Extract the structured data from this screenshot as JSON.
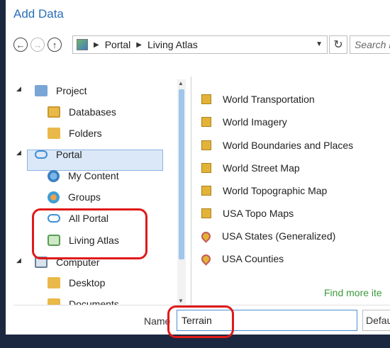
{
  "dialog": {
    "title": "Add Data"
  },
  "nav": {
    "back_icon": "back-arrow-icon",
    "forward_icon": "forward-arrow-icon",
    "up_icon": "up-arrow-icon",
    "breadcrumb": [
      "Portal",
      "Living Atlas"
    ],
    "refresh_icon": "refresh-icon",
    "search_placeholder": "Search L"
  },
  "tree": {
    "items": [
      {
        "label": "Project",
        "icon": "project-icon"
      },
      {
        "label": "Databases",
        "icon": "database-icon"
      },
      {
        "label": "Folders",
        "icon": "folder-icon"
      },
      {
        "label": "Portal",
        "icon": "cloud-icon"
      },
      {
        "label": "My Content",
        "icon": "globe-user-icon"
      },
      {
        "label": "Groups",
        "icon": "groups-icon"
      },
      {
        "label": "All Portal",
        "icon": "cloud-icon"
      },
      {
        "label": "Living Atlas",
        "icon": "living-atlas-icon"
      },
      {
        "label": "Computer",
        "icon": "computer-icon"
      },
      {
        "label": "Desktop",
        "icon": "folder-icon"
      },
      {
        "label": "Documents",
        "icon": "folder-icon"
      }
    ]
  },
  "list": {
    "items": [
      {
        "label": "World Transportation",
        "icon": "map-service-icon"
      },
      {
        "label": "World Imagery",
        "icon": "map-service-icon"
      },
      {
        "label": "World Boundaries and Places",
        "icon": "map-service-icon"
      },
      {
        "label": "World Street Map",
        "icon": "map-service-icon"
      },
      {
        "label": "World Topographic Map",
        "icon": "map-service-icon"
      },
      {
        "label": "USA Topo Maps",
        "icon": "map-service-icon"
      },
      {
        "label": "USA States (Generalized)",
        "icon": "feature-layer-icon"
      },
      {
        "label": "USA Counties",
        "icon": "feature-layer-icon"
      }
    ],
    "find_more": "Find more ite"
  },
  "footer": {
    "name_label": "Name",
    "name_value": "Terrain",
    "filter_label": "Defau"
  },
  "colors": {
    "title": "#2a6fb8",
    "selection": "#dbe8f7",
    "annotation": "#e01919",
    "find_more": "#3c9a3c"
  }
}
